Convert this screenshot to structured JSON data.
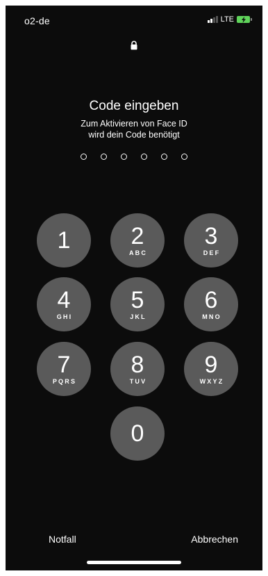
{
  "status_bar": {
    "carrier": "o2-de",
    "network": "LTE",
    "icons": [
      "signal-icon",
      "battery-charging-icon"
    ],
    "battery_color": "#5fd35a"
  },
  "lock_icon": "lock-icon",
  "prompt": {
    "title": "Code eingeben",
    "subtitle_line1": "Zum Aktivieren von Face ID",
    "subtitle_line2": "wird dein Code benötigt"
  },
  "passcode": {
    "length": 6,
    "filled": 0
  },
  "keypad": {
    "keys": [
      {
        "digit": "1",
        "letters": ""
      },
      {
        "digit": "2",
        "letters": "ABC"
      },
      {
        "digit": "3",
        "letters": "DEF"
      },
      {
        "digit": "4",
        "letters": "GHI"
      },
      {
        "digit": "5",
        "letters": "JKL"
      },
      {
        "digit": "6",
        "letters": "MNO"
      },
      {
        "digit": "7",
        "letters": "PQRS"
      },
      {
        "digit": "8",
        "letters": "TUV"
      },
      {
        "digit": "9",
        "letters": "WXYZ"
      },
      {
        "digit": "0",
        "letters": ""
      }
    ],
    "key_color": "#5a5a5a"
  },
  "actions": {
    "emergency": "Notfall",
    "cancel": "Abbrechen"
  }
}
